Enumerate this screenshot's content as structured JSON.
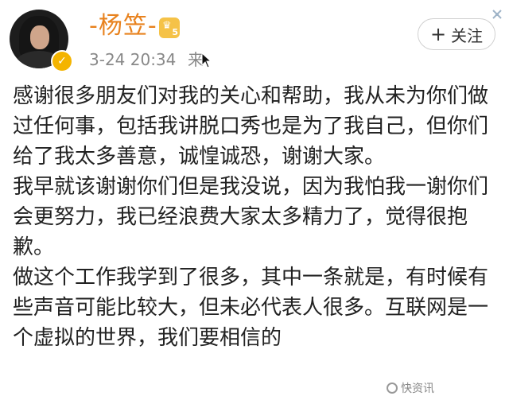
{
  "post": {
    "username": "-杨笠-",
    "level": "5",
    "time": "3-24 20:34",
    "source": "来",
    "follow_label": "关注",
    "paragraphs": [
      "感谢很多朋友们对我的关心和帮助，我从未为你们做过任何事，包括我讲脱口秀也是为了我自己，但你们给了我太多善意，诚惶诚恐，谢谢大家。",
      "我早就该谢谢你们但是我没说，因为我怕我一谢你们会更努力，我已经浪费大家太多精力了，觉得很抱歉。",
      "做这个工作我学到了很多，其中一条就是，有时候有些声音可能比较大，但未必代表人很多。互联网是一个虚拟的世界，我们要相信的"
    ]
  },
  "watermark": "快资讯",
  "icons": [
    "avatar",
    "verified-icon",
    "level-badge-icon",
    "plus-icon",
    "close-icon",
    "cursor-icon"
  ],
  "colors": {
    "username": "#e8821e",
    "meta": "#888888",
    "text": "#222222",
    "badge": "#f4b400"
  }
}
